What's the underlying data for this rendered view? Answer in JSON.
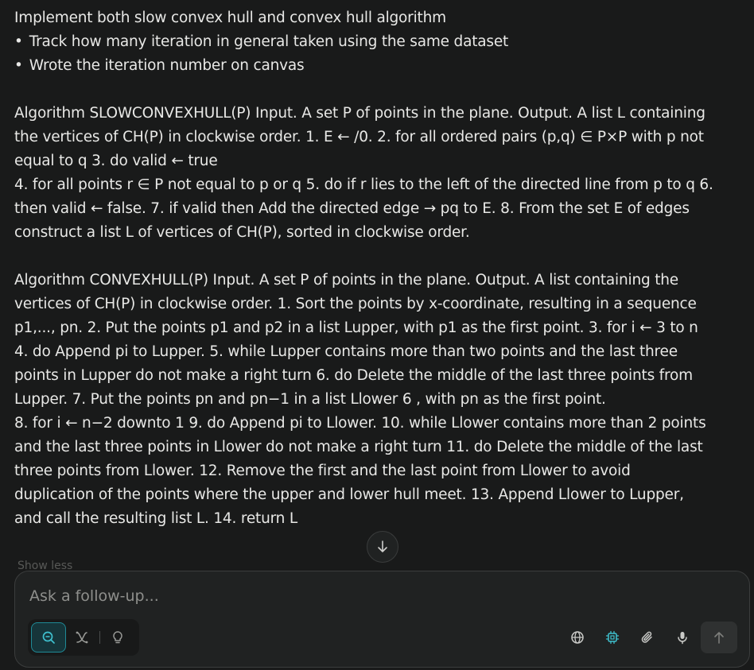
{
  "message": {
    "title": "Implement both slow convex hull and convex hull algorithm",
    "bullets": [
      "Track how many iteration in general taken using the same dataset",
      "Wrote the iteration number on canvas"
    ],
    "para1a": "Algorithm SLOWCONVEXHULL(P) Input. A set P of points in the plane. Output. A list L containing the vertices of CH(P) in clockwise order. 1. E ← /0. 2. for all ordered pairs (p,q) ∈ P×P with p not equal to q 3. do valid ← true",
    "para1b": "4. for all points r ∈ P not equal to p or q 5. do if r lies to the left of the directed line from p to q 6. then valid ← false. 7. if valid then Add the directed edge → pq to E. 8. From the set E of edges construct a list L of vertices of CH(P), sorted in clockwise order.",
    "para2a": "Algorithm CONVEXHULL(P) Input. A set P of points in the plane. Output. A list containing the vertices of CH(P) in clockwise order. 1. Sort the points by x-coordinate, resulting in a sequence p1,..., pn. 2. Put the points p1 and p2 in a list Lupper, with p1 as the first point. 3. for i ← 3 to n 4. do Append pi to Lupper. 5. while Lupper contains more than two points and the last three points in Lupper do not make a right turn 6. do Delete the middle of the last three points from Lupper. 7. Put the points pn and pn−1 in a list Llower 6 , with pn as the first point.",
    "para2b": "8. for i ← n−2 downto 1 9. do Append pi to Llower. 10. while Llower contains more than 2 points and the last three points in Llower do not make a right turn 11. do Delete the middle of the last three points from Llower. 12. Remove the first and the last point from Llower to avoid duplication of the points where the upper and lower hull meet. 13. Append Llower to Lupper, and call the resulting list L. 14. return L"
  },
  "show_less_label": "Show less",
  "composer": {
    "placeholder": "Ask a follow-up...",
    "modes": [
      "search",
      "research",
      "labs"
    ],
    "active_mode": "search",
    "tools": [
      "globe-icon",
      "cpu-icon",
      "paperclip-icon",
      "microphone-icon"
    ],
    "accent_color": "#3fc1cf"
  }
}
